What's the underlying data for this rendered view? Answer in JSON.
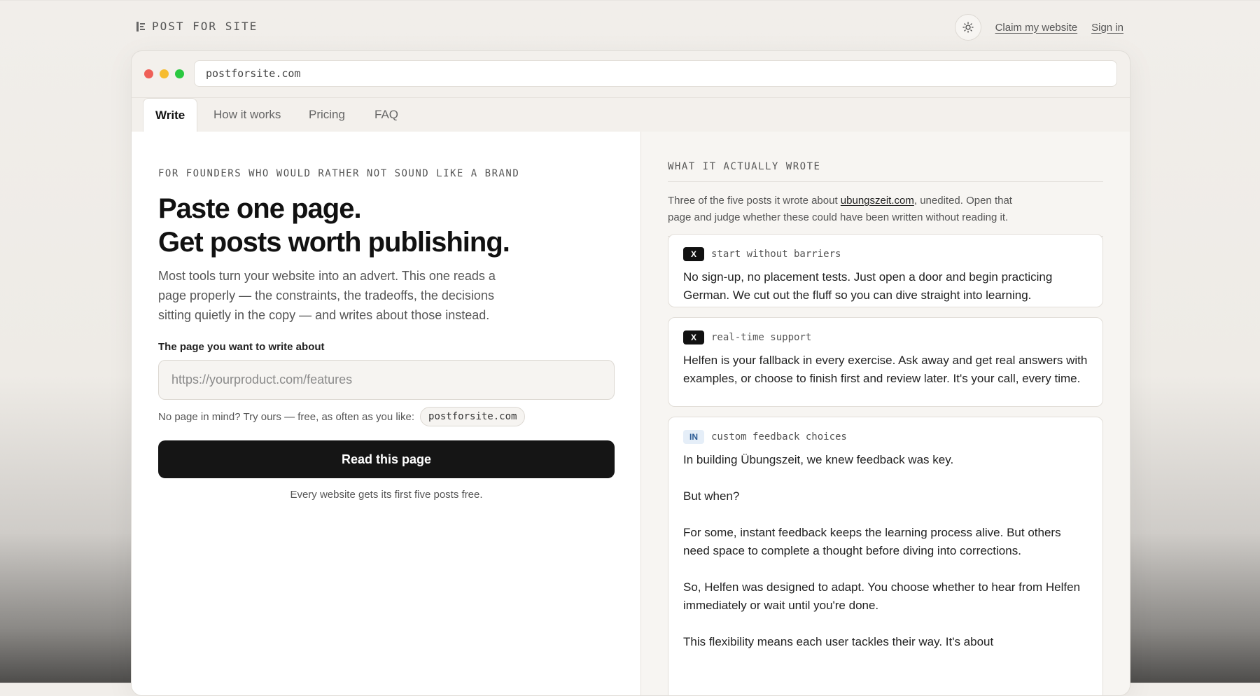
{
  "brand": {
    "name": "POST FOR SITE"
  },
  "topnav": {
    "claim": "Claim my website",
    "signin": "Sign in"
  },
  "browser": {
    "url": "postforsite.com"
  },
  "tabs": [
    {
      "label": "Write"
    },
    {
      "label": "How it works"
    },
    {
      "label": "Pricing"
    },
    {
      "label": "FAQ"
    }
  ],
  "hero": {
    "eyebrow": "FOR FOUNDERS WHO WOULD RATHER NOT SOUND LIKE A BRAND",
    "title_line1": "Paste one page.",
    "title_line2": "Get posts worth publishing.",
    "lede": "Most tools turn your website into an advert. This one reads a page properly — the constraints, the tradeoffs, the decisions sitting quietly in the copy — and writes about those instead."
  },
  "form": {
    "label": "The page you want to write about",
    "placeholder": "https://yourproduct.com/features",
    "hint": "No page in mind? Try ours — free, as often as you like:",
    "hint_chip": "postforsite.com",
    "cta": "Read this page",
    "footnote": "Every website gets its first five posts free."
  },
  "examples": {
    "heading": "WHAT IT ACTUALLY WROTE",
    "intro_before": "Three of the five posts it wrote about ",
    "intro_link": "ubungszeit.com",
    "intro_after": ", unedited. Open that page and judge whether these could have been written without reading it.",
    "cards": [
      {
        "badge": "X",
        "tag": "start without barriers",
        "paragraphs": [
          "No sign-up, no placement tests. Just open a door and begin practicing German. We cut out the fluff so you can dive straight into learning."
        ]
      },
      {
        "badge": "X",
        "tag": "real-time support",
        "paragraphs": [
          "Helfen is your fallback in every exercise. Ask away and get real answers with examples, or choose to finish first and review later. It's your call, every time."
        ]
      },
      {
        "badge": "IN",
        "tag": "custom feedback choices",
        "paragraphs": [
          "In building Übungszeit, we knew feedback was key.",
          "But when?",
          "For some, instant feedback keeps the learning process alive. But others need space to complete a thought before diving into corrections.",
          "So, Helfen was designed to adapt. You choose whether to hear from Helfen immediately or wait until you're done.",
          "This flexibility means each user tackles their way. It's about"
        ]
      }
    ]
  }
}
